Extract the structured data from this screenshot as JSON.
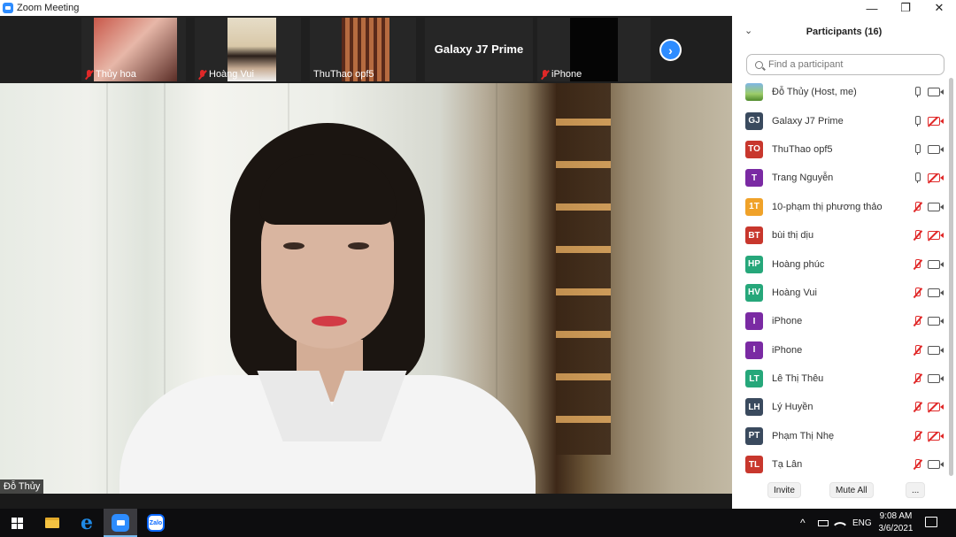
{
  "window": {
    "title": "Zoom Meeting",
    "minimize": "—",
    "restore": "❐",
    "close": "✕"
  },
  "thumbnails": [
    {
      "name": "Thủy hoa",
      "muted": true
    },
    {
      "name": "Hoàng Vui",
      "muted": true
    },
    {
      "name": "ThuThao opf5",
      "muted": false
    },
    {
      "name": "Galaxy J7 Prime",
      "muted": false
    },
    {
      "name": "iPhone",
      "muted": true
    }
  ],
  "next_page": "›",
  "active_speaker": "Đỗ Thủy",
  "participants_panel": {
    "title": "Participants (16)",
    "collapse_icon": "⌄",
    "search_placeholder": "Find a participant",
    "participants": [
      {
        "name": "Đỗ Thủy (Host, me)",
        "initials": "",
        "color": "#5aa0d8",
        "mic": "on",
        "cam": "on",
        "photo": true
      },
      {
        "name": "Galaxy J7 Prime",
        "initials": "GJ",
        "color": "#3a4a5e",
        "mic": "on",
        "cam": "off"
      },
      {
        "name": "ThuThao opf5",
        "initials": "TO",
        "color": "#c8372d",
        "mic": "on",
        "cam": "on"
      },
      {
        "name": "Trang Nguyễn",
        "initials": "T",
        "color": "#7a2aa3",
        "mic": "on",
        "cam": "off"
      },
      {
        "name": "10-phạm thị phương thảo",
        "initials": "1T",
        "color": "#f0a229",
        "mic": "muted",
        "cam": "on"
      },
      {
        "name": "bùi thị dịu",
        "initials": "BT",
        "color": "#c8372d",
        "mic": "muted",
        "cam": "off"
      },
      {
        "name": "Hoàng phúc",
        "initials": "HP",
        "color": "#26a77a",
        "mic": "muted",
        "cam": "on"
      },
      {
        "name": "Hoàng Vui",
        "initials": "HV",
        "color": "#26a77a",
        "mic": "muted",
        "cam": "on"
      },
      {
        "name": "iPhone",
        "initials": "I",
        "color": "#7a2aa3",
        "mic": "muted",
        "cam": "on"
      },
      {
        "name": "iPhone",
        "initials": "I",
        "color": "#7a2aa3",
        "mic": "muted",
        "cam": "on"
      },
      {
        "name": "Lê Thị Thêu",
        "initials": "LT",
        "color": "#26a77a",
        "mic": "muted",
        "cam": "on"
      },
      {
        "name": "Lý Huyền",
        "initials": "LH",
        "color": "#3a4a5e",
        "mic": "muted",
        "cam": "off"
      },
      {
        "name": "Phạm Thị Nhẹ",
        "initials": "PT",
        "color": "#3a4a5e",
        "mic": "muted",
        "cam": "off"
      },
      {
        "name": "Tạ Lân",
        "initials": "TL",
        "color": "#c8372d",
        "mic": "muted",
        "cam": "on"
      }
    ],
    "invite_label": "Invite",
    "mute_all_label": "Mute All",
    "more_label": "..."
  },
  "taskbar": {
    "start_icon": "windows-logo",
    "apps": [
      "file-explorer",
      "edge",
      "zoom",
      "zalo"
    ],
    "zalo_text": "Zalo",
    "tray_chevron": "^",
    "language": "ENG",
    "time": "9:08 AM",
    "date": "3/6/2021"
  },
  "colors": {
    "zoom_blue": "#2d8cff",
    "muted_red": "#e02828",
    "taskbar": "#0d0d0f"
  }
}
